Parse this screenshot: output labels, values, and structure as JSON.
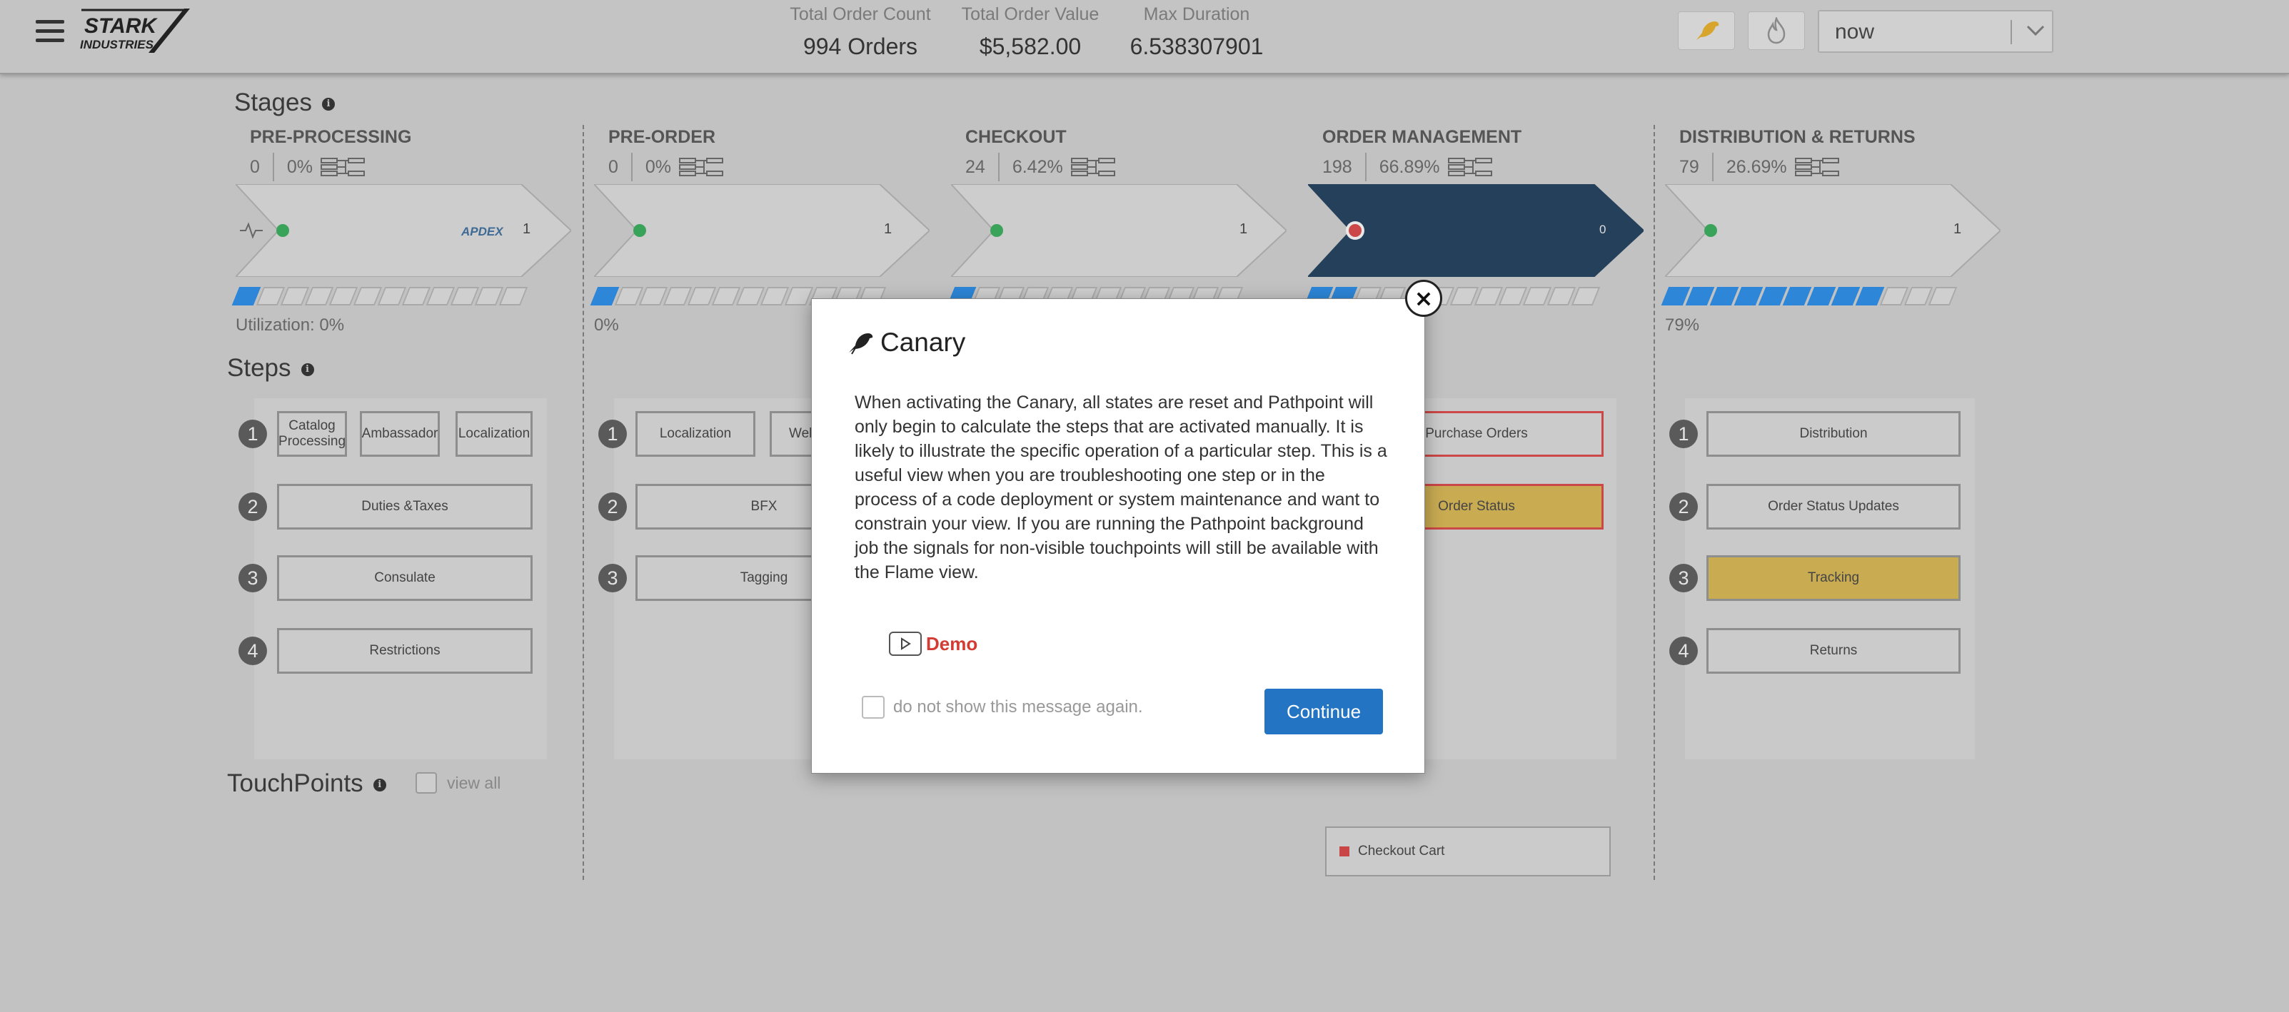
{
  "header": {
    "brand_line1": "STARK",
    "brand_line2": "INDUSTRIES",
    "metrics": [
      {
        "label": "Total Order Count",
        "value": "994 Orders"
      },
      {
        "label": "Total Order Value",
        "value": "$5,582.00"
      },
      {
        "label": "Max Duration",
        "value": "6.538307901"
      }
    ],
    "time_select": "now",
    "canary_icon": "canary-bird-icon",
    "flame_icon": "flame-icon"
  },
  "sections": {
    "stages": "Stages",
    "steps": "Steps",
    "touchpoints": "TouchPoints",
    "view_all": "view all"
  },
  "stages": [
    {
      "title": "PRE-PROCESSING",
      "count": "0",
      "pct": "0%",
      "chev_count": "1",
      "apdex": "APDEX",
      "util": "Utilization: 0%",
      "bar_on": 1,
      "status": "green"
    },
    {
      "title": "PRE-ORDER",
      "count": "0",
      "pct": "0%",
      "chev_count": "1",
      "util": "0%",
      "bar_on": 1,
      "status": "green"
    },
    {
      "title": "CHECKOUT",
      "count": "24",
      "pct": "6.42%",
      "chev_count": "1",
      "util": "",
      "bar_on": 1,
      "status": "green"
    },
    {
      "title": "ORDER MANAGEMENT",
      "count": "198",
      "pct": "66.89%",
      "chev_count": "0",
      "util": "",
      "bar_on": 2,
      "status": "red"
    },
    {
      "title": "DISTRIBUTION & RETURNS",
      "count": "79",
      "pct": "26.69%",
      "chev_count": "1",
      "util": "79%",
      "bar_on": 9,
      "status": "green"
    }
  ],
  "steps": {
    "preprocessing": {
      "row1": [
        "Catalog Processing",
        "Ambassador",
        "Localization"
      ],
      "row2": "Duties &Taxes",
      "row3": "Consulate",
      "row4": "Restrictions"
    },
    "preorder": {
      "row1": [
        "Localization",
        "Wel"
      ],
      "row2": "BFX",
      "row3": "Tagging"
    },
    "ordermgmt": {
      "row1": "Purchase Orders",
      "row2": "Order Status"
    },
    "distribution": {
      "row1": "Distribution",
      "row2": "Order Status Updates",
      "row3": "Tracking",
      "row4": "Returns"
    },
    "numbers": [
      "1",
      "2",
      "3",
      "4"
    ]
  },
  "touchpoint": "Checkout Cart",
  "modal": {
    "title": "Canary",
    "body": "When activating the Canary, all states are reset and Pathpoint will only begin to calculate the steps that are activated manually. It is likely to illustrate the specific operation of a particular step. This is a useful view when you are troubleshooting one step or in the process of a code deployment or system maintenance and want to constrain your view. If you are running the Pathpoint background job the signals for non-visible touchpoints will still be available with the Flame view.",
    "demo_label": "Demo",
    "dont_show": "do not show this message again.",
    "continue": "Continue",
    "close": "×"
  }
}
